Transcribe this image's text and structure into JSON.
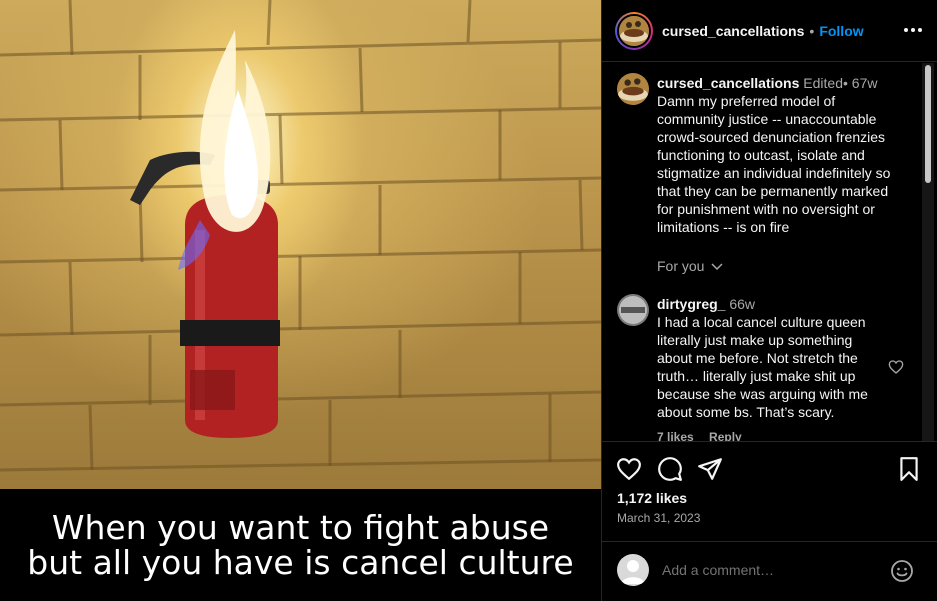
{
  "media": {
    "caption": "When you want to fight abuse\nbut all you have is cancel culture"
  },
  "header": {
    "username": "cursed_cancellations",
    "separator": "•",
    "follow_label": "Follow"
  },
  "comments": [
    {
      "username": "cursed_cancellations",
      "edited": "Edited",
      "separator": "•",
      "age": "67w",
      "text": "Damn my preferred model of community justice -- unaccountable crowd-sourced denunciation frenzies functioning to outcast, isolate and stigmatize an individual indefinitely so that they can be permanently marked for punishment with no oversight or limitations -- is on fire"
    },
    {
      "username": "dirtygreg_",
      "age": "66w",
      "text": "I had a local cancel culture queen literally just make up something about me before. Not stretch the truth… literally just make shit up because she was arguing with me about some bs. That’s scary.",
      "likes": "7 likes",
      "reply_label": "Reply"
    }
  ],
  "for_you_label": "For you",
  "actions": {
    "like_icon": "heart-icon",
    "comment_icon": "comment-bubble-icon",
    "share_icon": "paper-plane-icon",
    "save_icon": "bookmark-icon"
  },
  "likes_count": "1,172 likes",
  "date": "March 31, 2023",
  "add_comment": {
    "placeholder": "Add a comment…"
  },
  "colors": {
    "accent": "#0095f6",
    "background": "#000000",
    "muted_text": "#a8a8a8"
  }
}
